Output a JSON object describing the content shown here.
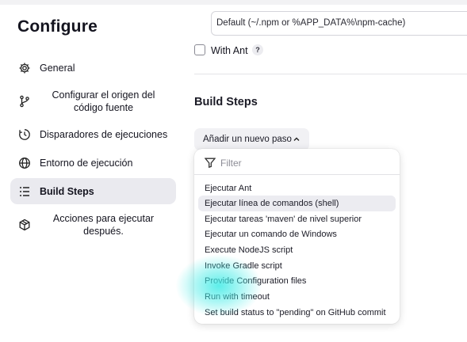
{
  "sidebar": {
    "title": "Configure",
    "items": [
      {
        "label": "General",
        "icon": "gear-icon"
      },
      {
        "label": "Configurar el origen del código fuente",
        "icon": "branch-icon"
      },
      {
        "label": "Disparadores de ejecuciones",
        "icon": "clock-icon"
      },
      {
        "label": "Entorno de ejecución",
        "icon": "globe-icon"
      },
      {
        "label": "Build Steps",
        "icon": "list-icon",
        "active": true
      },
      {
        "label": "Acciones para ejecutar después.",
        "icon": "package-icon"
      }
    ]
  },
  "main": {
    "cache_field_value": "Default (~/.npm or %APP_DATA%\\npm-cache)",
    "with_ant_label": "With Ant",
    "help_label": "?",
    "section_title": "Build Steps",
    "add_step_label": "Añadir un nuevo paso"
  },
  "dropdown": {
    "filter_placeholder": "Filter",
    "items": [
      "Ejecutar Ant",
      "Ejecutar línea de comandos (shell)",
      "Ejecutar tareas 'maven' de nivel superior",
      "Ejecutar un comando de Windows",
      "Execute NodeJS script",
      "Invoke Gradle script",
      "Provide Configuration files",
      "Run with timeout",
      "Set build status to \"pending\" on GitHub commit"
    ],
    "hovered_index": 1
  },
  "colors": {
    "active_nav_bg": "#eaeaef",
    "hover_item_bg": "#ececf1",
    "cursor_highlight": "#40ebe6"
  }
}
